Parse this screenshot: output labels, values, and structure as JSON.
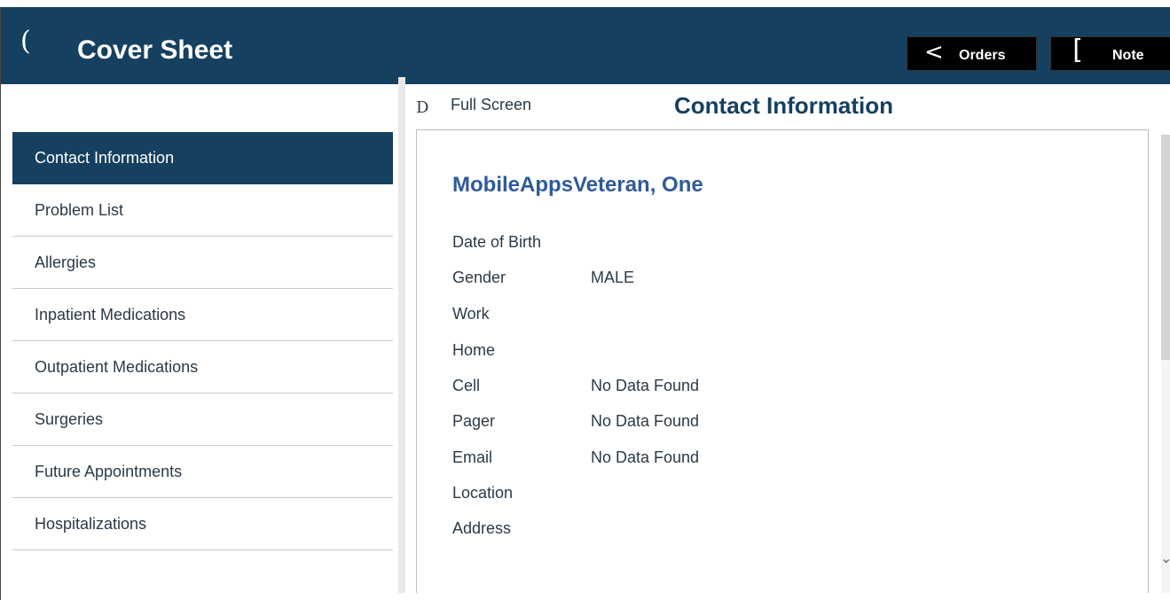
{
  "header": {
    "back_glyph": "(",
    "title": "Cover Sheet",
    "orders_glyph": "<",
    "orders_label": "Orders",
    "note_glyph": "[",
    "note_label": "Note"
  },
  "sidebar": {
    "items": [
      {
        "label": "Contact Information",
        "active": true
      },
      {
        "label": "Problem List"
      },
      {
        "label": "Allergies"
      },
      {
        "label": "Inpatient Medications"
      },
      {
        "label": "Outpatient Medications"
      },
      {
        "label": "Surgeries"
      },
      {
        "label": "Future Appointments"
      },
      {
        "label": "Hospitalizations"
      }
    ]
  },
  "content": {
    "fullscreen_glyph": "D",
    "fullscreen_label": "Full Screen",
    "title": "Contact Information",
    "patient_name": "MobileAppsVeteran, One",
    "fields": [
      {
        "label": "Date of Birth",
        "value": ""
      },
      {
        "label": "Gender",
        "value": "MALE"
      },
      {
        "label": "Work",
        "value": ""
      },
      {
        "label": "Home",
        "value": ""
      },
      {
        "label": "Cell",
        "value": "No Data Found"
      },
      {
        "label": "Pager",
        "value": "No Data Found"
      },
      {
        "label": "Email",
        "value": "No Data Found"
      },
      {
        "label": "Location",
        "value": ""
      },
      {
        "label": "Address",
        "value": ""
      }
    ]
  },
  "colors": {
    "header_bg": "#16405f",
    "active_nav_bg": "#16405f",
    "patient_name": "#2f5a9a"
  }
}
